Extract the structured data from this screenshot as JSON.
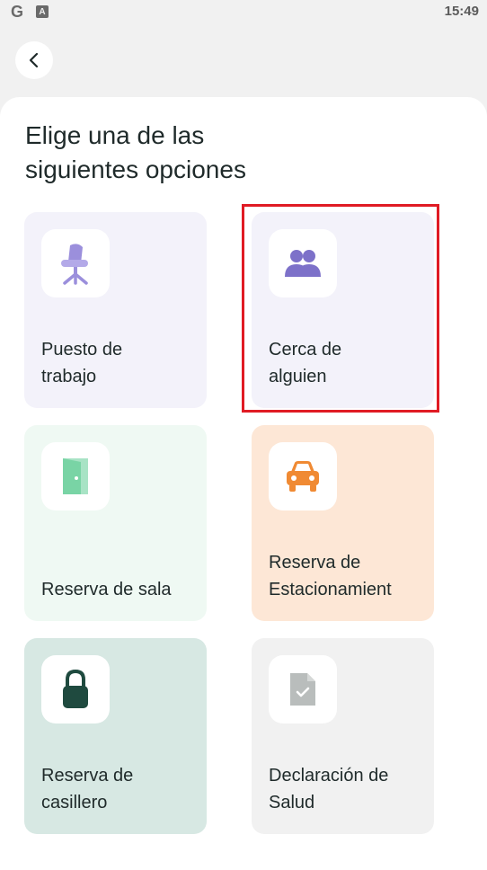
{
  "status_bar": {
    "left_icons": [
      "G",
      "A"
    ],
    "time": "15:49"
  },
  "header": {
    "back_icon": "chevron-left-icon"
  },
  "title": {
    "line1": "Elige una de las",
    "line2": "siguientes opciones"
  },
  "options": [
    {
      "line1": "Puesto de",
      "line2": "trabajo",
      "icon": "office-chair-icon",
      "bg": "#f3f2fa",
      "icon_color": "#9b8fdc"
    },
    {
      "line1": "Cerca de",
      "line2": "alguien",
      "icon": "people-icon",
      "bg": "#f3f2fa",
      "icon_color": "#7d71c9"
    },
    {
      "line1": "",
      "line2": "Reserva de sala",
      "icon": "door-icon",
      "bg": "#eff9f3",
      "icon_color": "#79d4a5"
    },
    {
      "line1": "Reserva de",
      "line2": "Estacionamient",
      "icon": "car-icon",
      "bg": "#fde7d6",
      "icon_color": "#f08a33"
    },
    {
      "line1": "Reserva de",
      "line2": "casillero",
      "icon": "lock-icon",
      "bg": "#d7e8e3",
      "icon_color": "#1f4a3f"
    },
    {
      "line1": "Declaración de",
      "line2": "Salud",
      "icon": "document-check-icon",
      "bg": "#f1f1f1",
      "icon_color": "#b9bdbc"
    }
  ],
  "highlight_color": "#e01b24"
}
